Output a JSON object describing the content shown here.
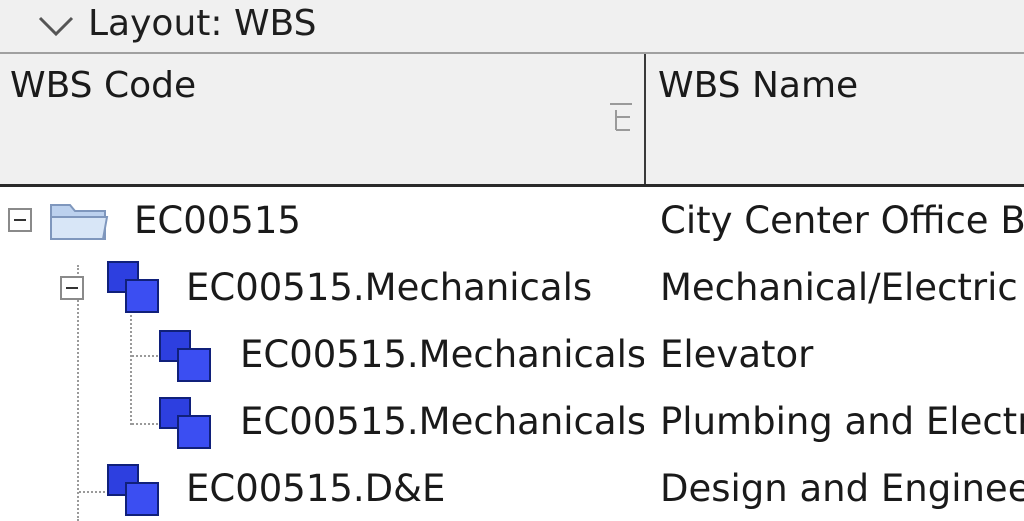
{
  "layout_bar": {
    "title": "Layout: WBS",
    "icon": "chevron-down-icon"
  },
  "columns": {
    "code": "WBS Code",
    "name": "WBS Name",
    "sort_icon": "column-options-icon"
  },
  "rows": [
    {
      "code": "EC00515",
      "name": "City Center Office Bu",
      "icon": "folder-icon",
      "level": 0,
      "expanded": true
    },
    {
      "code": "EC00515.Mechanicals",
      "name": "Mechanical/Electric",
      "icon": "wbs-node-icon",
      "level": 1,
      "expanded": true
    },
    {
      "code": "EC00515.Mechanicals",
      "name": "Elevator",
      "icon": "wbs-node-icon",
      "level": 2
    },
    {
      "code": "EC00515.Mechanicals",
      "name": "Plumbing and Electri",
      "icon": "wbs-node-icon",
      "level": 2
    },
    {
      "code": "EC00515.D&E",
      "name": "Design and Enginee",
      "icon": "wbs-node-icon",
      "level": 1
    }
  ],
  "colors": {
    "wbs_node": "#2d3fe0",
    "folder": "#a9c3e6",
    "header_bg": "#f0f0f0"
  }
}
